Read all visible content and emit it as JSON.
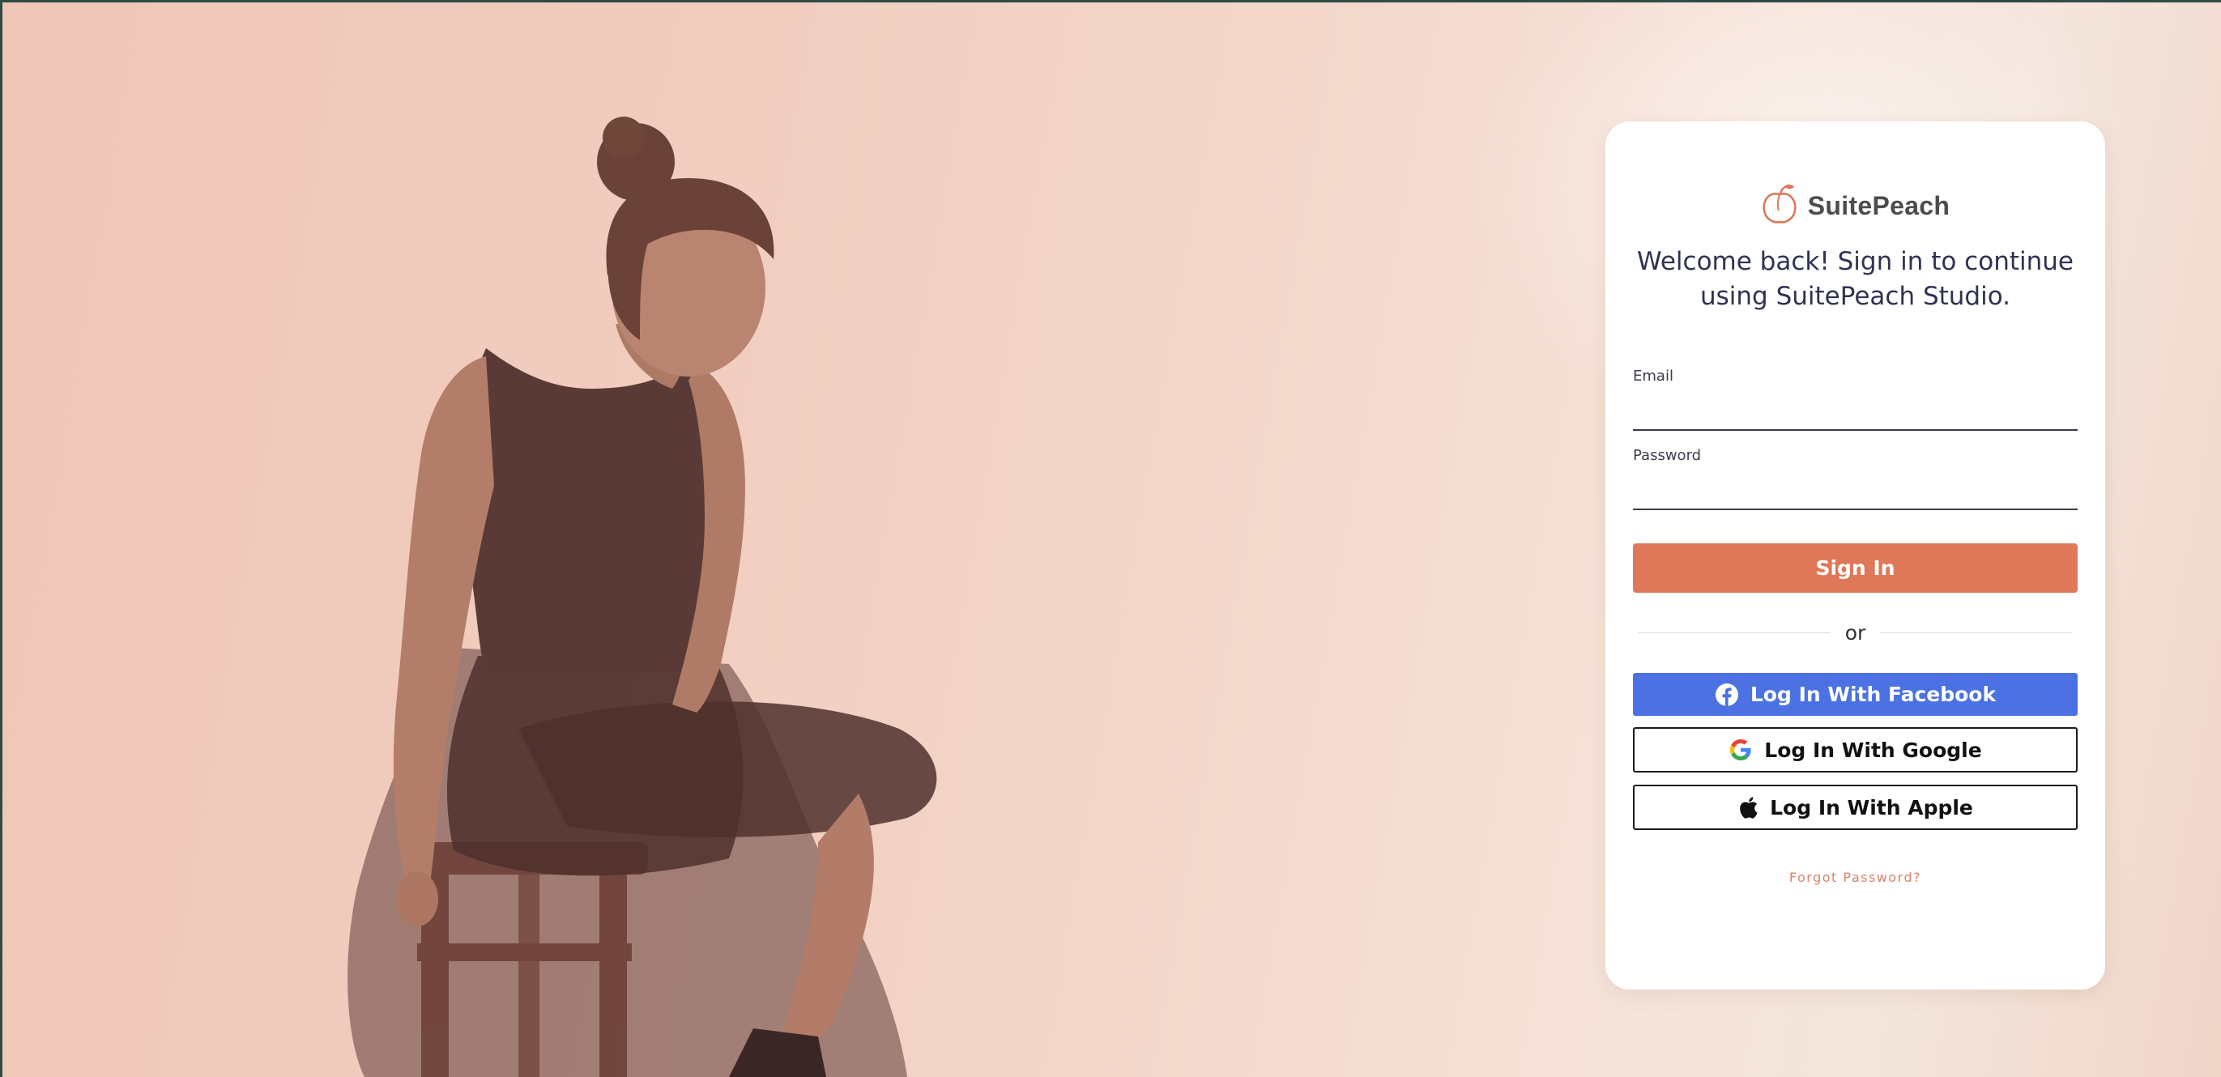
{
  "brand": {
    "name": "SuitePeach",
    "accent": "#de7858",
    "logo_icon": "peach-icon"
  },
  "welcome": {
    "line1": "Welcome back! Sign in to continue",
    "line2": "using SuitePeach Studio."
  },
  "form": {
    "email_label": "Email",
    "email_value": "",
    "password_label": "Password",
    "password_value": "",
    "signin_label": "Sign In"
  },
  "divider": {
    "text": "or"
  },
  "social": {
    "facebook_label": "Log In With Facebook",
    "facebook_color": "#4b71e2",
    "facebook_icon": "facebook-icon",
    "google_label": "Log In With Google",
    "google_icon": "google-icon",
    "apple_label": "Log In With Apple",
    "apple_icon": "apple-icon"
  },
  "forgot_label": "Forgot Password?"
}
